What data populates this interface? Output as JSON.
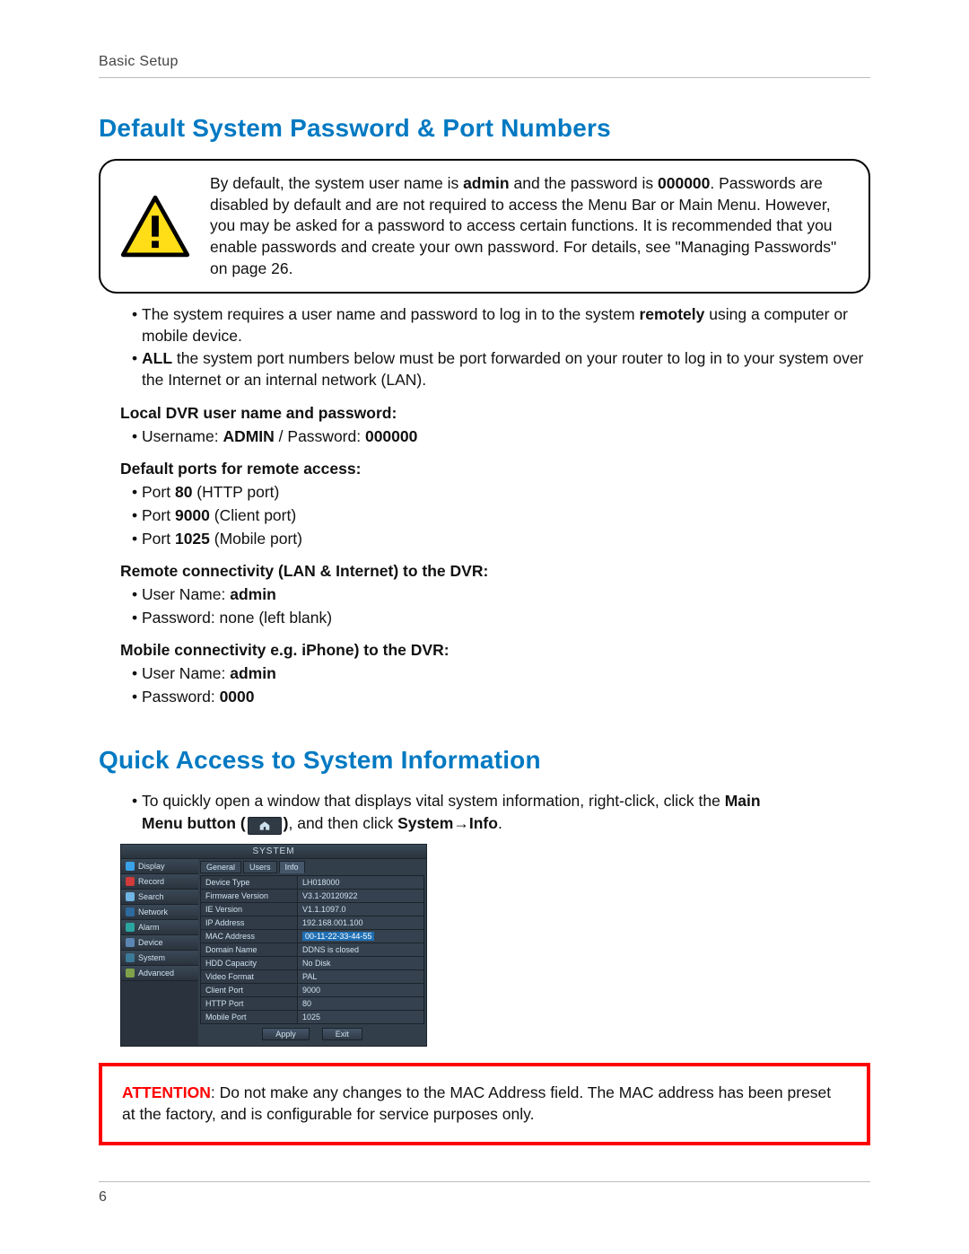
{
  "header": {
    "section": "Basic Setup"
  },
  "page_number": "6",
  "h1": "Default System Password & Port Numbers",
  "callout": {
    "pre": "By default, the system user name is ",
    "admin": "admin",
    "mid1": " and the password is ",
    "pw": "000000",
    "rest": ". Passwords are disabled by default and are not required to access the Menu Bar or Main Menu. However, you may be asked for a password to access certain functions. It is recommended that you enable passwords and create your own password. For details, see \"Managing Passwords\" on page 26."
  },
  "bullets_top": {
    "a_pre": "The system requires a user name and password to log in to the system ",
    "a_bold": "remotely",
    "a_post": " using a computer or mobile device.",
    "b_bold": "ALL",
    "b_post": " the system port numbers below must be port forwarded on your router to log in to your system over the Internet or an internal network (LAN)."
  },
  "local": {
    "head": "Local DVR user name and password:",
    "line_pre": "Username: ",
    "user": "ADMIN",
    "line_mid": " / Password: ",
    "pass": "000000"
  },
  "ports": {
    "head": "Default ports for remote access:",
    "p1_pre": "Port ",
    "p1_num": "80",
    "p1_post": " (HTTP port)",
    "p2_pre": "Port ",
    "p2_num": "9000",
    "p2_post": " (Client port)",
    "p3_pre": "Port ",
    "p3_num": "1025",
    "p3_post": " (Mobile port)"
  },
  "remote": {
    "head": "Remote connectivity (LAN & Internet) to the DVR:",
    "u_pre": "User Name: ",
    "u_val": "admin",
    "p": "Password: none (left blank)"
  },
  "mobile": {
    "head": "Mobile connectivity e.g. iPhone) to the DVR:",
    "u_pre": "User Name: ",
    "u_val": "admin",
    "p_pre": "Password: ",
    "p_val": "0000"
  },
  "h2": "Quick Access to System Information",
  "quick": {
    "a_pre": "To quickly open a window that displays vital system information, right-click, click the ",
    "a_bold": "Main",
    "b_bold_pre": "Menu button (",
    "b_bold_post": ")",
    "b_mid": ", and then click ",
    "b_sys": "System",
    "b_arrow": "→",
    "b_info": "Info",
    "b_period": "."
  },
  "panel": {
    "title": "SYSTEM",
    "side": [
      "Display",
      "Record",
      "Search",
      "Network",
      "Alarm",
      "Device",
      "System",
      "Advanced"
    ],
    "side_colors": [
      "#3aa2e8",
      "#d13b3b",
      "#6fb4e2",
      "#2d6a9e",
      "#2aa5a0",
      "#5b86b4",
      "#3a7a98",
      "#7fa24a"
    ],
    "tabs": [
      "General",
      "Users",
      "Info"
    ],
    "rows": [
      {
        "k": "Device Type",
        "v": "LH018000"
      },
      {
        "k": "Firmware Version",
        "v": "V3.1-20120922"
      },
      {
        "k": "IE Version",
        "v": "V1.1.1097.0"
      },
      {
        "k": "IP Address",
        "v": "192.168.001.100"
      },
      {
        "k": "MAC Address",
        "v": "00-11-22-33-44-55",
        "hilite": true
      },
      {
        "k": "Domain Name",
        "v": "DDNS is closed"
      },
      {
        "k": "HDD Capacity",
        "v": "No Disk"
      },
      {
        "k": "Video Format",
        "v": "PAL"
      },
      {
        "k": "Client Port",
        "v": "9000"
      },
      {
        "k": "HTTP Port",
        "v": "80"
      },
      {
        "k": "Mobile Port",
        "v": "1025"
      }
    ],
    "buttons": {
      "apply": "Apply",
      "exit": "Exit"
    }
  },
  "attention": {
    "lead": "ATTENTION",
    "text": ": Do not make any changes to the MAC Address field. The MAC address has been preset at the factory, and is configurable for service purposes only."
  }
}
